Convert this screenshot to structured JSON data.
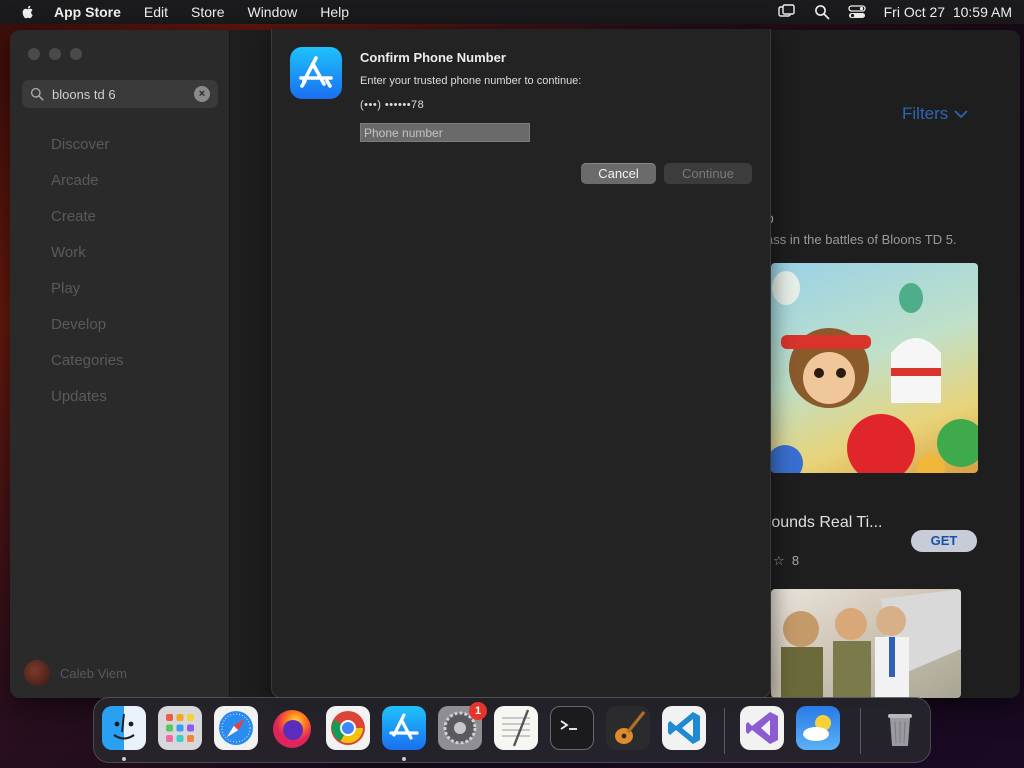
{
  "menubar": {
    "app_name": "App Store",
    "menus": [
      "Edit",
      "Store",
      "Window",
      "Help"
    ],
    "clock": "Fri Oct 27  10:59 AM"
  },
  "sidebar": {
    "search": {
      "value": "bloons td 6"
    },
    "items": [
      {
        "label": "Discover"
      },
      {
        "label": "Arcade"
      },
      {
        "label": "Create"
      },
      {
        "label": "Work"
      },
      {
        "label": "Play"
      },
      {
        "label": "Develop"
      },
      {
        "label": "Categories"
      },
      {
        "label": "Updates"
      }
    ],
    "profile_name": "Caleb Viem"
  },
  "content": {
    "filters_label": "Filters",
    "result1_title_fragment": "p",
    "result1_subtitle_fragment": "ass in the battles of Bloons TD 5.",
    "result2_title_fragment": "rounds Real Ti...",
    "get_label": "GET",
    "rating_fragment": "☆  8"
  },
  "dialog": {
    "title": "Confirm Phone Number",
    "prompt": "Enter your trusted phone number to continue:",
    "masked_number": "(•••) ••••••78",
    "phone_placeholder": "Phone number",
    "phone_value": "",
    "cancel_label": "Cancel",
    "continue_label": "Continue"
  },
  "dock": {
    "apps": [
      "finder",
      "launchpad",
      "safari",
      "firefox",
      "chrome",
      "app-store",
      "system-settings",
      "textedit",
      "terminal",
      "garageband",
      "vscode",
      "visual-studio",
      "weather",
      "trash"
    ],
    "settings_badge": "1"
  },
  "colors": {
    "accent_blue": "#2c64b8",
    "badge_red": "#e5342b"
  }
}
